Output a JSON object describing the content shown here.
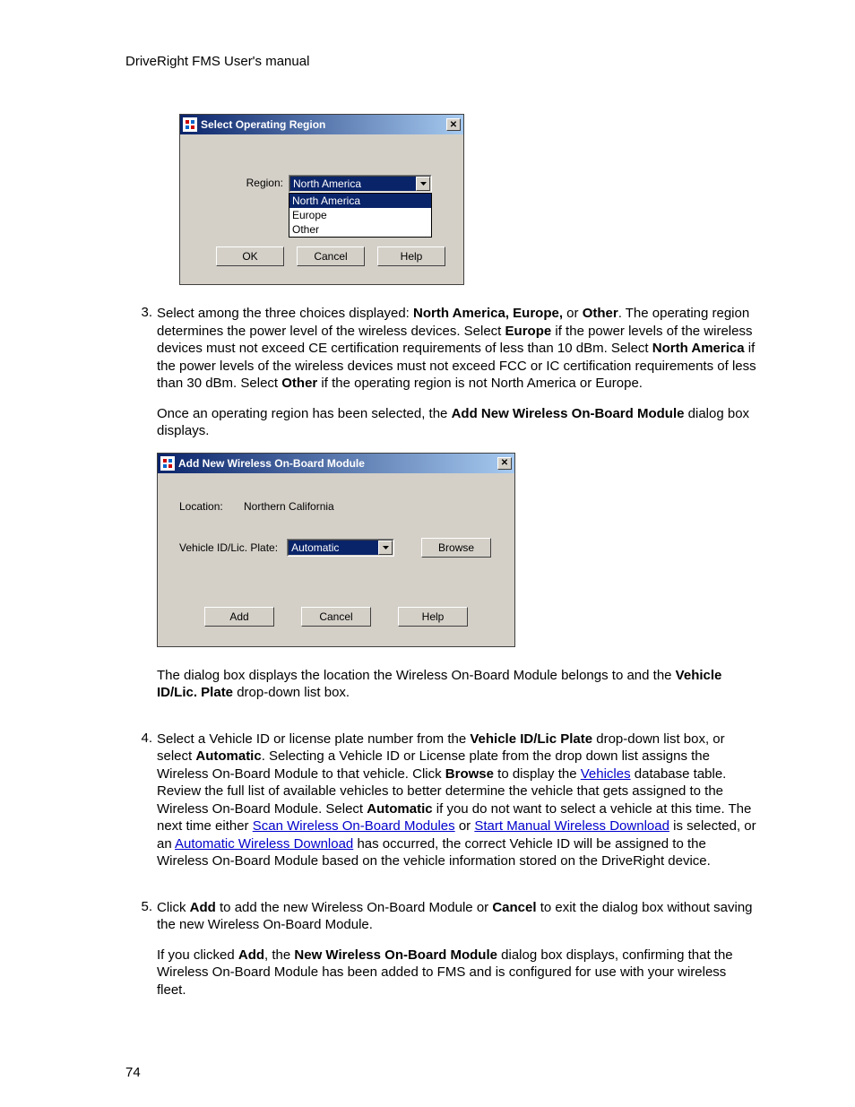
{
  "header": "DriveRight FMS User's manual",
  "page_number": "74",
  "dialog1": {
    "title": "Select Operating Region",
    "region_label": "Region:",
    "region_value": "North America",
    "options": [
      "North America",
      "Europe",
      "Other"
    ],
    "ok": "OK",
    "cancel": "Cancel",
    "help": "Help"
  },
  "dialog2": {
    "title": "Add New Wireless On-Board Module",
    "location_label": "Location:",
    "location_value": "Northern California",
    "vid_label": "Vehicle ID/Lic. Plate:",
    "vid_value": "Automatic",
    "browse": "Browse",
    "add": "Add",
    "cancel": "Cancel",
    "help": "Help"
  },
  "items": {
    "3": {
      "num": "3.",
      "p1_a": "Select among the three choices displayed: ",
      "p1_b": "North America, Europe,",
      "p1_c": " or ",
      "p1_d": "Other",
      "p1_e": ". The operating region determines the power level of the wireless devices. Select ",
      "p1_f": "Europe",
      "p1_g": " if the power levels of the wireless devices must not exceed CE certification requirements of less than 10 dBm. Select ",
      "p1_h": "North America",
      "p1_i": " if the power levels of the wireless devices must not exceed FCC or IC certification requirements of less than 30 dBm. Select ",
      "p1_j": "Other",
      "p1_k": " if the operating region is not North America or Europe.",
      "p2_a": "Once an operating region has been selected, the ",
      "p2_b": "Add New Wireless On-Board Module",
      "p2_c": " dialog box displays.",
      "p3_a": "The dialog box displays the location the Wireless On-Board Module belongs to and the ",
      "p3_b": "Vehicle ID/Lic. Plate",
      "p3_c": " drop-down list box."
    },
    "4": {
      "num": "4.",
      "p1_a": "Select a Vehicle ID or license plate number from the ",
      "p1_b": "Vehicle ID/Lic Plate",
      "p1_c": " drop-down list box, or select ",
      "p1_d": "Automatic",
      "p1_e": ". Selecting a Vehicle ID or License plate from the drop down list assigns the Wireless On-Board Module to that vehicle. Click ",
      "p1_f": "Browse",
      "p1_g": " to display the ",
      "p1_h": "Vehicles",
      "p1_i": " database table. Review the full list of available vehicles to better determine the vehicle that gets assigned to the Wireless On-Board Module. Select ",
      "p1_j": "Automatic",
      "p1_k": " if you do not want to select a vehicle at this time. The next time either ",
      "p1_l": "Scan Wireless On-Board Modules",
      "p1_m": " or ",
      "p1_n": "Start Manual Wireless Download",
      "p1_o": " is selected, or an ",
      "p1_p": "Automatic Wireless Download",
      "p1_q": " has occurred, the correct Vehicle ID will be assigned to the Wireless On-Board Module based on the vehicle information stored on the DriveRight device."
    },
    "5": {
      "num": "5.",
      "p1_a": "Click ",
      "p1_b": "Add",
      "p1_c": " to add the new Wireless On-Board Module or ",
      "p1_d": "Cancel",
      "p1_e": " to exit the dialog box without saving the new Wireless On-Board Module.",
      "p2_a": "If you clicked ",
      "p2_b": "Add",
      "p2_c": ", the ",
      "p2_d": "New Wireless On-Board Module",
      "p2_e": " dialog box displays, confirming that the Wireless On-Board Module has been added to FMS and is configured for use with your wireless fleet."
    }
  }
}
